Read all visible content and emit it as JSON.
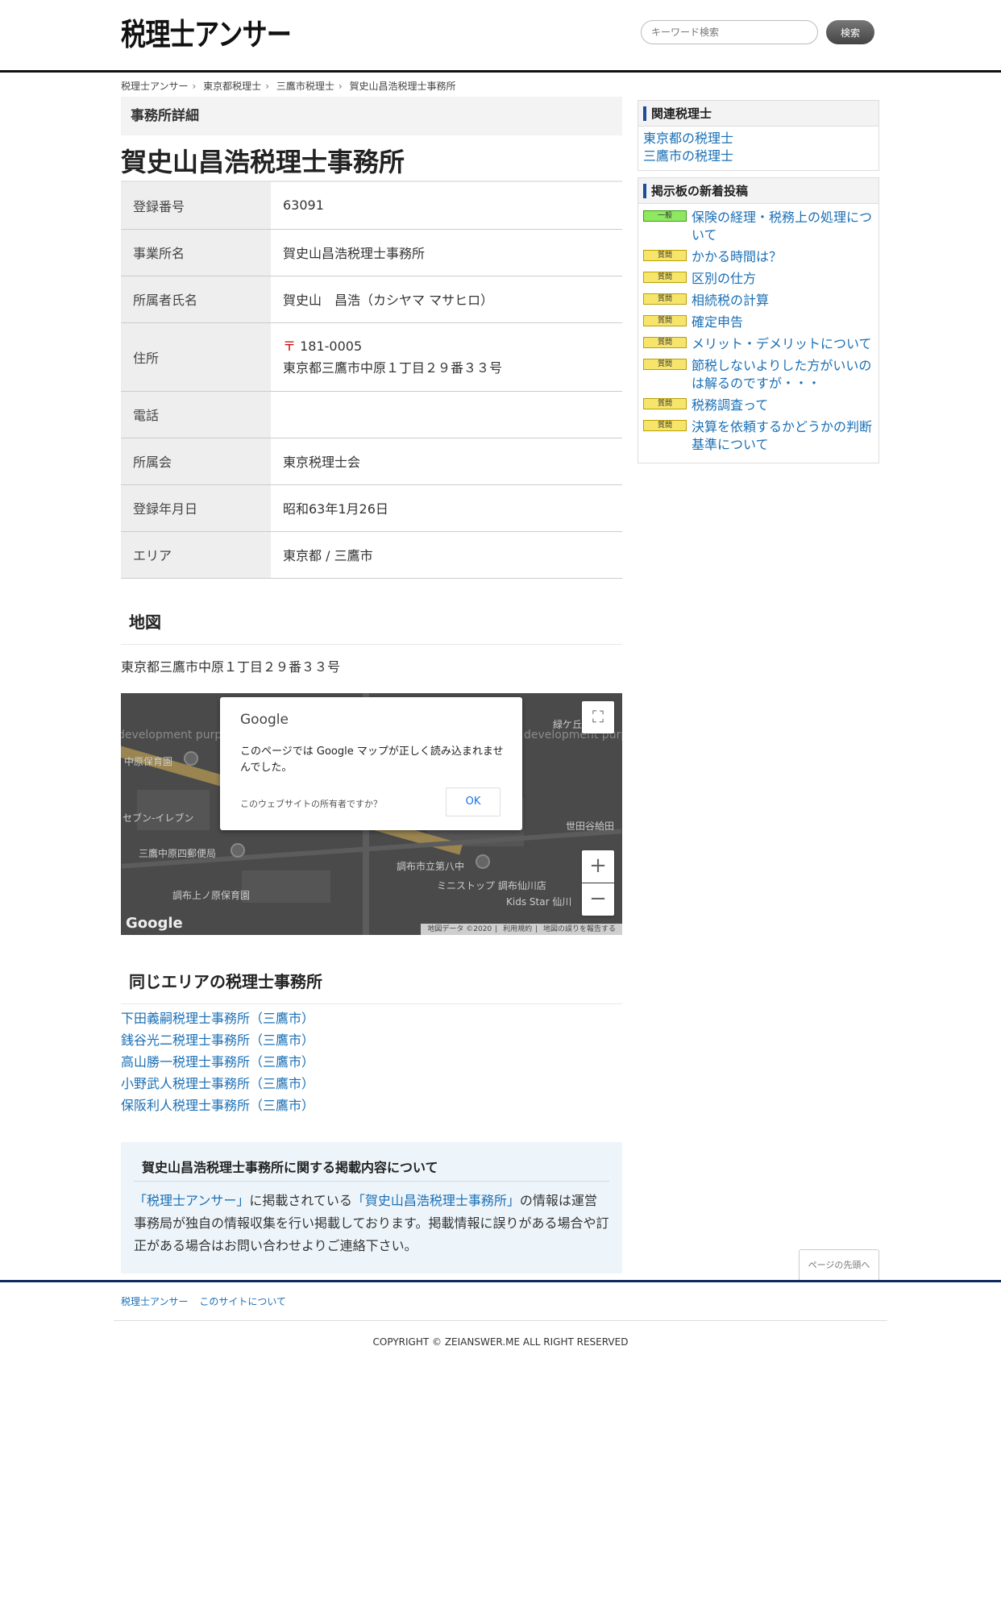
{
  "header": {
    "logo": "税理士アンサー",
    "search_placeholder": "キーワード検索",
    "search_button": "検索"
  },
  "breadcrumb": [
    "税理士アンサー",
    "東京都税理士",
    "三鷹市税理士",
    "賀史山昌浩税理士事務所"
  ],
  "main": {
    "section_title": "事務所詳細",
    "office_name": "賀史山昌浩税理士事務所",
    "details": {
      "reg_no_label": "登録番号",
      "reg_no": "63091",
      "office_label": "事業所名",
      "office": "賀史山昌浩税理士事務所",
      "person_label": "所属者氏名",
      "person": "賀史山　昌浩（カシヤマ マサヒロ）",
      "address_label": "住所",
      "postal_mark": "〒",
      "postal": "181-0005",
      "address": "東京都三鷹市中原１丁目２９番３３号",
      "phone_label": "電話",
      "phone": "",
      "assoc_label": "所属会",
      "assoc": "東京税理士会",
      "date_label": "登録年月日",
      "date": "昭和63年1月26日",
      "area_label": "エリア",
      "area": "東京都 / 三鷹市"
    },
    "map_heading": "地図",
    "map_address": "東京都三鷹市中原１丁目２９番３３号",
    "map": {
      "dialog_logo": "Google",
      "dialog_message": "このページでは Google マップが正しく読み込まれませんでした。",
      "dialog_owner": "このウェブサイトの所有者ですか？",
      "dialog_ok": "OK",
      "watermark": "development purposes only",
      "labels": [
        "中原保育園",
        "三鷹中原四郵便局",
        "調布上ノ原保育園",
        "調布市立第八中",
        "ミニストップ 調布仙川店",
        "Kids Star 仙川",
        "世田谷給田",
        "セブン-イレブン",
        "緑ケ丘"
      ],
      "attribution": [
        "地図データ ©2020",
        "利用規約",
        "地図の誤りを報告する"
      ],
      "google_mark": "Google",
      "zoom_in": "+",
      "zoom_out": "−",
      "fullscreen": "⛶"
    },
    "same_area_heading": "同じエリアの税理士事務所",
    "same_area": [
      "下田義嗣税理士事務所（三鷹市）",
      "銭谷光二税理士事務所（三鷹市）",
      "高山勝一税理士事務所（三鷹市）",
      "小野武人税理士事務所（三鷹市）",
      "保阪利人税理士事務所（三鷹市）"
    ],
    "about": {
      "title": "賀史山昌浩税理士事務所に関する掲載内容について",
      "link1": "「税理士アンサー」",
      "text1": "に掲載されている",
      "link2": "「賀史山昌浩税理士事務所」",
      "text2": "の情報は運営事務局が独自の情報収集を行い掲載しております。掲載情報に誤りがある場合や訂正がある場合はお問い合わせよりご連絡下さい。"
    }
  },
  "sidebar": {
    "related_title": "関連税理士",
    "related_links": [
      "東京都の税理士",
      "三鷹市の税理士"
    ],
    "posts_title": "掲示板の新着投稿",
    "posts": [
      {
        "badge": "一般",
        "type": "general",
        "title": "保険の経理・税務上の処理について"
      },
      {
        "badge": "質問",
        "type": "question",
        "title": "かかる時間は？"
      },
      {
        "badge": "質問",
        "type": "question",
        "title": "区別の仕方"
      },
      {
        "badge": "質問",
        "type": "question",
        "title": "相続税の計算"
      },
      {
        "badge": "質問",
        "type": "question",
        "title": "確定申告"
      },
      {
        "badge": "質問",
        "type": "question",
        "title": "メリット・デメリットについて"
      },
      {
        "badge": "質問",
        "type": "question",
        "title": "節税しないよりした方がいいのは解るのですが・・・"
      },
      {
        "badge": "質問",
        "type": "question",
        "title": "税務調査って"
      },
      {
        "badge": "質問",
        "type": "question",
        "title": "決算を依頼するかどうかの判断基準について"
      }
    ]
  },
  "footer": {
    "back_to_top": "ページの先頭へ",
    "nav": [
      "税理士アンサー",
      "このサイトについて"
    ],
    "copyright": "COPYRIGHT © ZEIANSWER.ME ALL RIGHT RESERVED"
  }
}
